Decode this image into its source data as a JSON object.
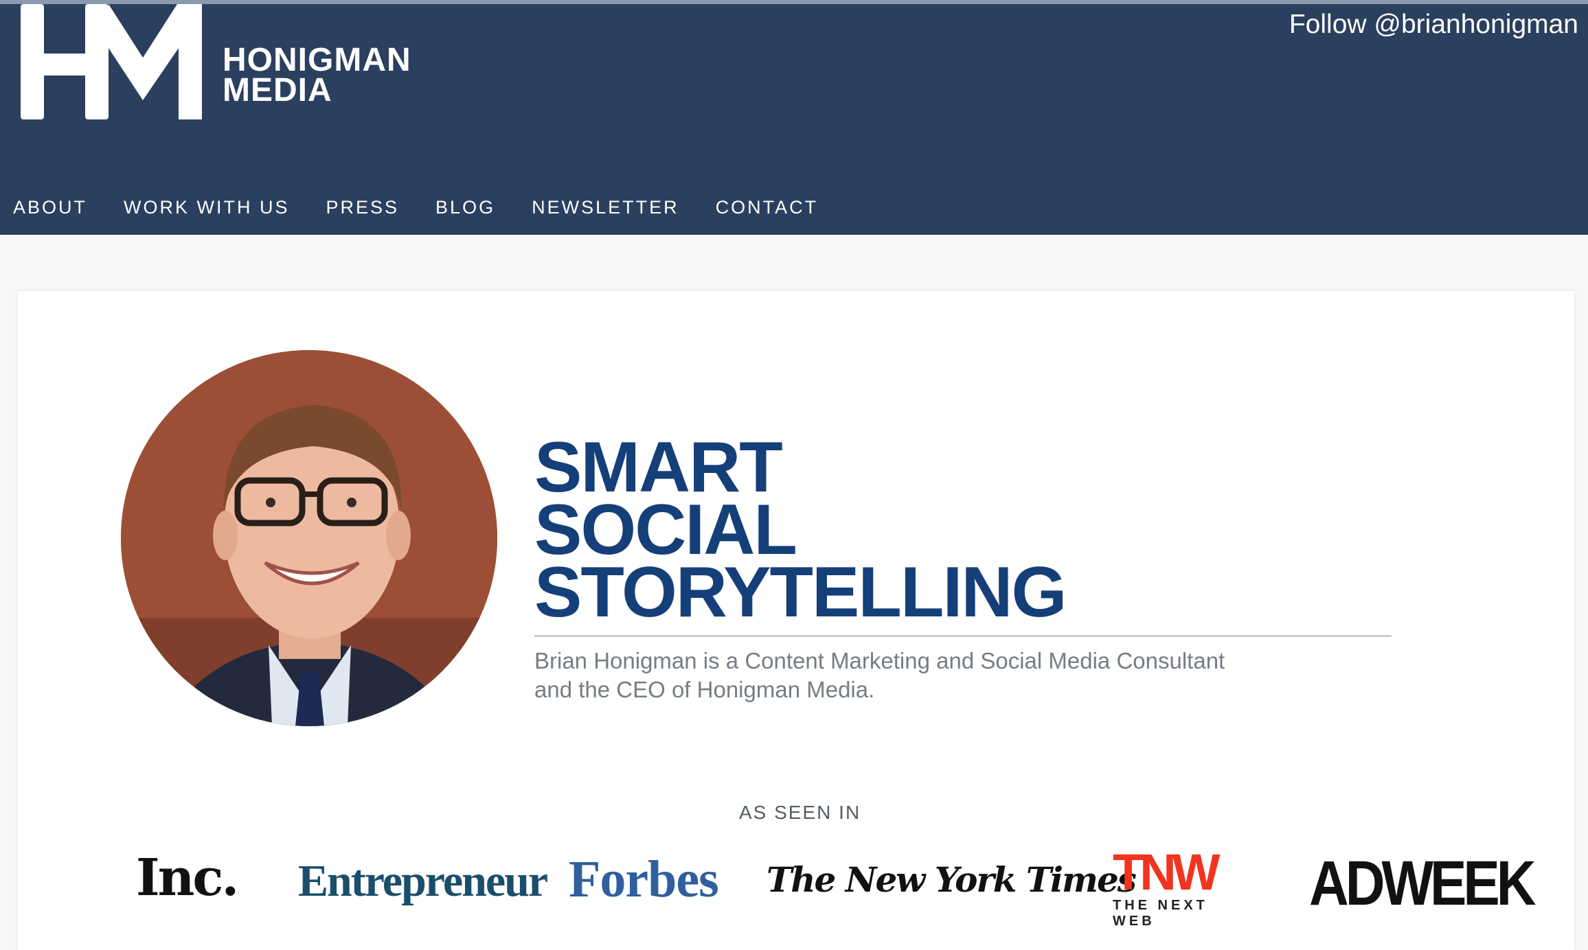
{
  "header": {
    "brand_line1": "HONIGMAN",
    "brand_line2": "MEDIA",
    "follow_text": "Follow @brianhonigman"
  },
  "nav": {
    "items": [
      {
        "label": "ABOUT"
      },
      {
        "label": "WORK WITH US"
      },
      {
        "label": "PRESS"
      },
      {
        "label": "BLOG"
      },
      {
        "label": "NEWSLETTER"
      },
      {
        "label": "CONTACT"
      }
    ]
  },
  "hero": {
    "headline_lines": [
      "SMART",
      "SOCIAL",
      "STORYTELLING"
    ],
    "intro_line1": "Brian Honigman is a Content Marketing and Social Media Consultant",
    "intro_line2": "and the CEO of Honigman Media."
  },
  "press": {
    "heading": "AS SEEN IN",
    "logos": [
      {
        "name": "Inc."
      },
      {
        "name": "Entrepreneur"
      },
      {
        "name": "Forbes"
      },
      {
        "name": "The New York Times"
      },
      {
        "name": "TNW",
        "sub": "THE NEXT WEB"
      },
      {
        "name": "ADWEEK"
      }
    ]
  },
  "colors": {
    "header_bg": "#2b3f5e",
    "headline": "#153f79",
    "tnw_red": "#f0341f"
  }
}
